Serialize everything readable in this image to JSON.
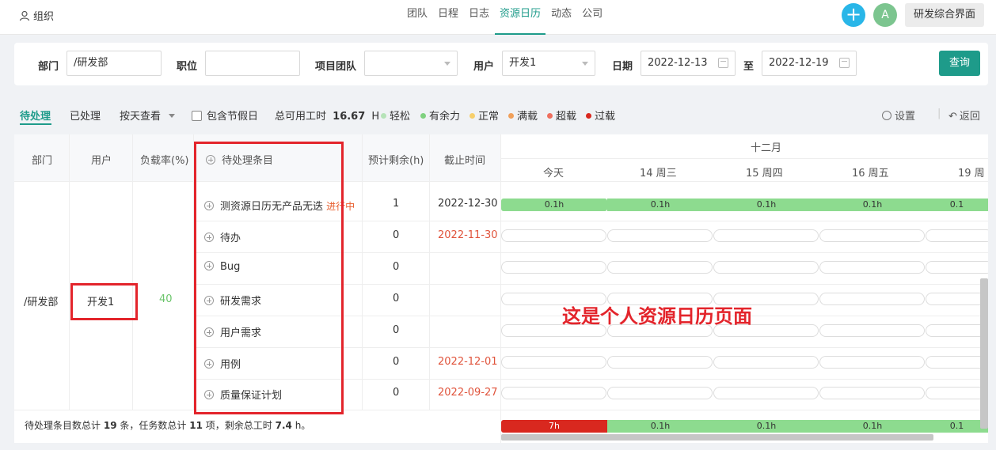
{
  "topbar": {
    "org_label": "组织",
    "nav": [
      "团队",
      "日程",
      "日志",
      "资源日历",
      "动态",
      "公司"
    ],
    "active_nav": "资源日历",
    "avatar_letter": "A",
    "workspace_button": "研发综合界面"
  },
  "filters": {
    "dept_label": "部门",
    "dept_value": "/研发部",
    "position_label": "职位",
    "position_value": "",
    "team_label": "项目团队",
    "team_value": "",
    "user_label": "用户",
    "user_value": "开发1",
    "date_label": "日期",
    "date_from": "2022-12-13",
    "date_sep": "至",
    "date_to": "2022-12-19",
    "query_button": "查询"
  },
  "toolbar": {
    "tab_pending": "待处理",
    "tab_done": "已处理",
    "view_by": "按天查看",
    "holiday_label": "包含节假日",
    "total_label": "总可用工时",
    "total_value": "16.67",
    "total_unit": "H",
    "legend": [
      {
        "label": "轻松",
        "color": "#b6e3b8"
      },
      {
        "label": "有余力",
        "color": "#7fd17f"
      },
      {
        "label": "正常",
        "color": "#f7cf6b"
      },
      {
        "label": "满载",
        "color": "#f0a05a"
      },
      {
        "label": "超载",
        "color": "#ef6f5e"
      },
      {
        "label": "过载",
        "color": "#d9281f"
      }
    ],
    "settings": "设置",
    "back": "返回"
  },
  "table": {
    "headers": {
      "dept": "部门",
      "user": "用户",
      "load": "负载率(%)",
      "item": "待处理条目",
      "remaining": "预计剩余(h)",
      "deadline": "截止时间",
      "month": "十二月"
    },
    "days": [
      "今天",
      "14 周三",
      "15 周四",
      "16 周五",
      "19 周"
    ],
    "dept": "/研发部",
    "user": "开发1",
    "load": "40",
    "rows": [
      {
        "item": "测资源日历无产品无迭",
        "status": "进行中",
        "remaining": "1",
        "deadline": "2022-12-30",
        "overdue": false
      },
      {
        "item": "待办",
        "status": "",
        "remaining": "0",
        "deadline": "2022-11-30",
        "overdue": true
      },
      {
        "item": "Bug",
        "status": "",
        "remaining": "0",
        "deadline": "",
        "overdue": false
      },
      {
        "item": "研发需求",
        "status": "",
        "remaining": "0",
        "deadline": "",
        "overdue": false
      },
      {
        "item": "用户需求",
        "status": "",
        "remaining": "0",
        "deadline": "",
        "overdue": false
      },
      {
        "item": "用例",
        "status": "",
        "remaining": "0",
        "deadline": "2022-12-01",
        "overdue": true
      },
      {
        "item": "质量保证计划",
        "status": "",
        "remaining": "0",
        "deadline": "2022-09-27",
        "overdue": true
      }
    ],
    "row1_bars": [
      "0.1h",
      "0.1h",
      "0.1h",
      "0.1h",
      "0.1"
    ],
    "footer_summary": {
      "prefix": "待处理条目数总计",
      "items_total": "19",
      "mid1": "条，任务数总计",
      "tasks_total": "11",
      "mid2": "项，剩余总工时",
      "hours_total": "7.4",
      "suffix": "h。"
    },
    "footer_bars": [
      "7h",
      "0.1h",
      "0.1h",
      "0.1h",
      "0.1"
    ]
  },
  "annotation": "这是个人资源日历页面"
}
